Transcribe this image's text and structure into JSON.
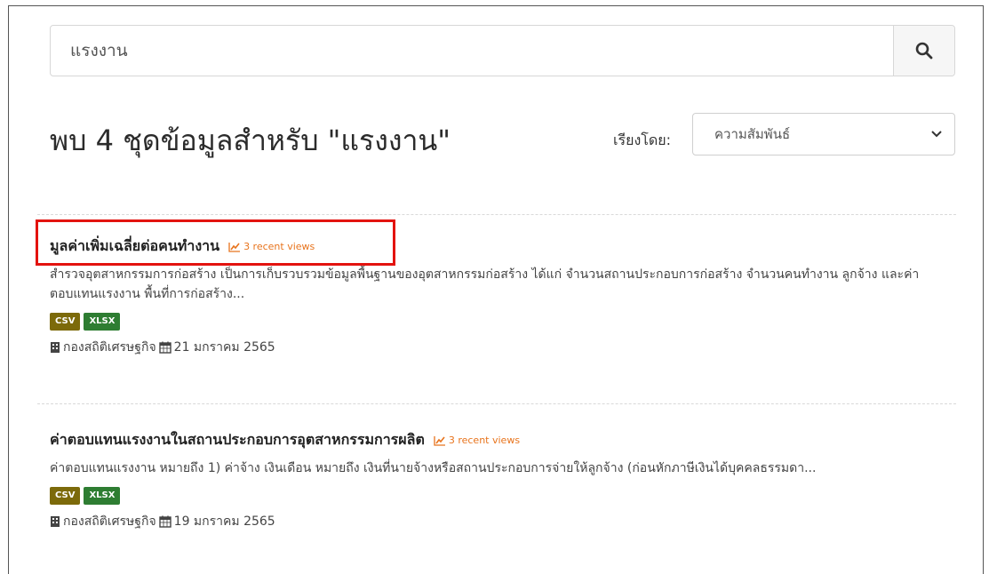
{
  "search": {
    "value": "แรงงาน"
  },
  "results_header": {
    "title": "พบ 4 ชุดข้อมูลสำหรับ \"แรงงาน\"",
    "sort_label": "เรียงโดย:",
    "sort_selected": "ความสัมพันธ์"
  },
  "results": [
    {
      "title": "มูลค่าเพิ่มเฉลี่ยต่อคนทำงาน",
      "views": "3 recent views",
      "description": "สำรวจอุตสาหกรรมการก่อสร้าง เป็นการเก็บรวบรวมข้อมูลพื้นฐานของอุตสาหกรรมก่อสร้าง ได้แก่ จำนวนสถานประกอบการก่อสร้าง จำนวนคนทำงาน ลูกจ้าง และค่าตอบแทนแรงงาน พื้นที่การก่อสร้าง...",
      "formats": [
        "CSV",
        "XLSX"
      ],
      "org": "กองสถิติเศรษฐกิจ",
      "date": "21 มกราคม 2565"
    },
    {
      "title": "ค่าตอบแทนแรงงานในสถานประกอบการอุตสาหกรรมการผลิต",
      "views": "3 recent views",
      "description": "ค่าตอบแทนแรงงาน หมายถึง 1) ค่าจ้าง เงินเดือน หมายถึง เงินที่นายจ้างหรือสถานประกอบการจ่ายให้ลูกจ้าง (ก่อนหักภาษีเงินได้บุคคลธรรมดา...",
      "formats": [
        "CSV",
        "XLSX"
      ],
      "org": "กองสถิติเศรษฐกิจ",
      "date": "19 มกราคม 2565"
    }
  ],
  "colors": {
    "highlight": "#e3130f",
    "views": "#e8741d",
    "csv": "#7c6a0a",
    "xlsx": "#2e7d32"
  }
}
